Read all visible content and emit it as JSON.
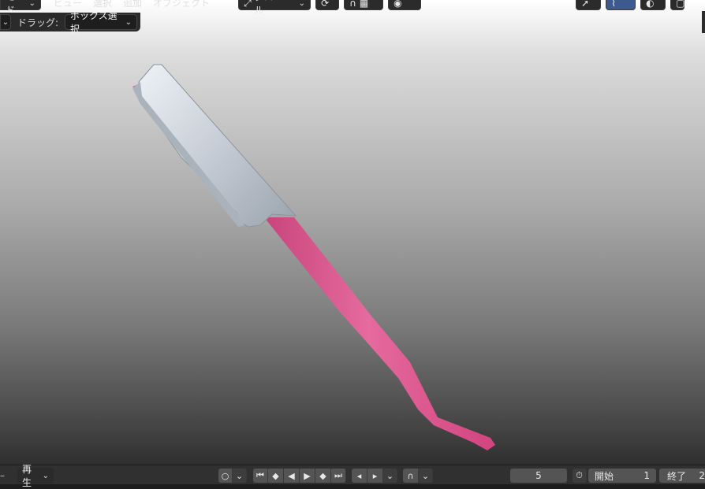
{
  "header": {
    "mode_label": "モード",
    "menu": [
      "ビュー",
      "選択",
      "追加",
      "オブジェクト"
    ],
    "transform_orientation": "グローバル"
  },
  "toolbar": {
    "drag_label": "ドラッグ:",
    "drag_value": "ボックス選択"
  },
  "timeline": {
    "playback_label": "再生",
    "current_frame": "5",
    "start_label": "開始",
    "start_value": "1",
    "end_label": "終了",
    "end_value_partial": "2"
  },
  "icons": {
    "transform": "transform-orientation-icon",
    "pivot": "pivot-icon",
    "snap": "magnet-icon",
    "proportional": "proportional-editing-icon",
    "gizmo": "gizmo-icon",
    "overlay": "overlay-icon",
    "autokey": "record-icon",
    "jump_start": "jump-start-icon",
    "prev_key": "prev-keyframe-icon",
    "play_reverse": "play-reverse-icon",
    "play": "play-icon",
    "next_key": "next-keyframe-icon",
    "jump_end": "jump-end-icon",
    "prev_frame": "prev-frame-icon",
    "next_frame": "next-frame-icon",
    "snap_timeline": "timeline-snap-icon",
    "stopwatch": "stopwatch-icon"
  },
  "colors": {
    "handle_pink": "#e0568f",
    "blade_silver": "#c9d0d9",
    "panel": "#2b2b2b"
  }
}
